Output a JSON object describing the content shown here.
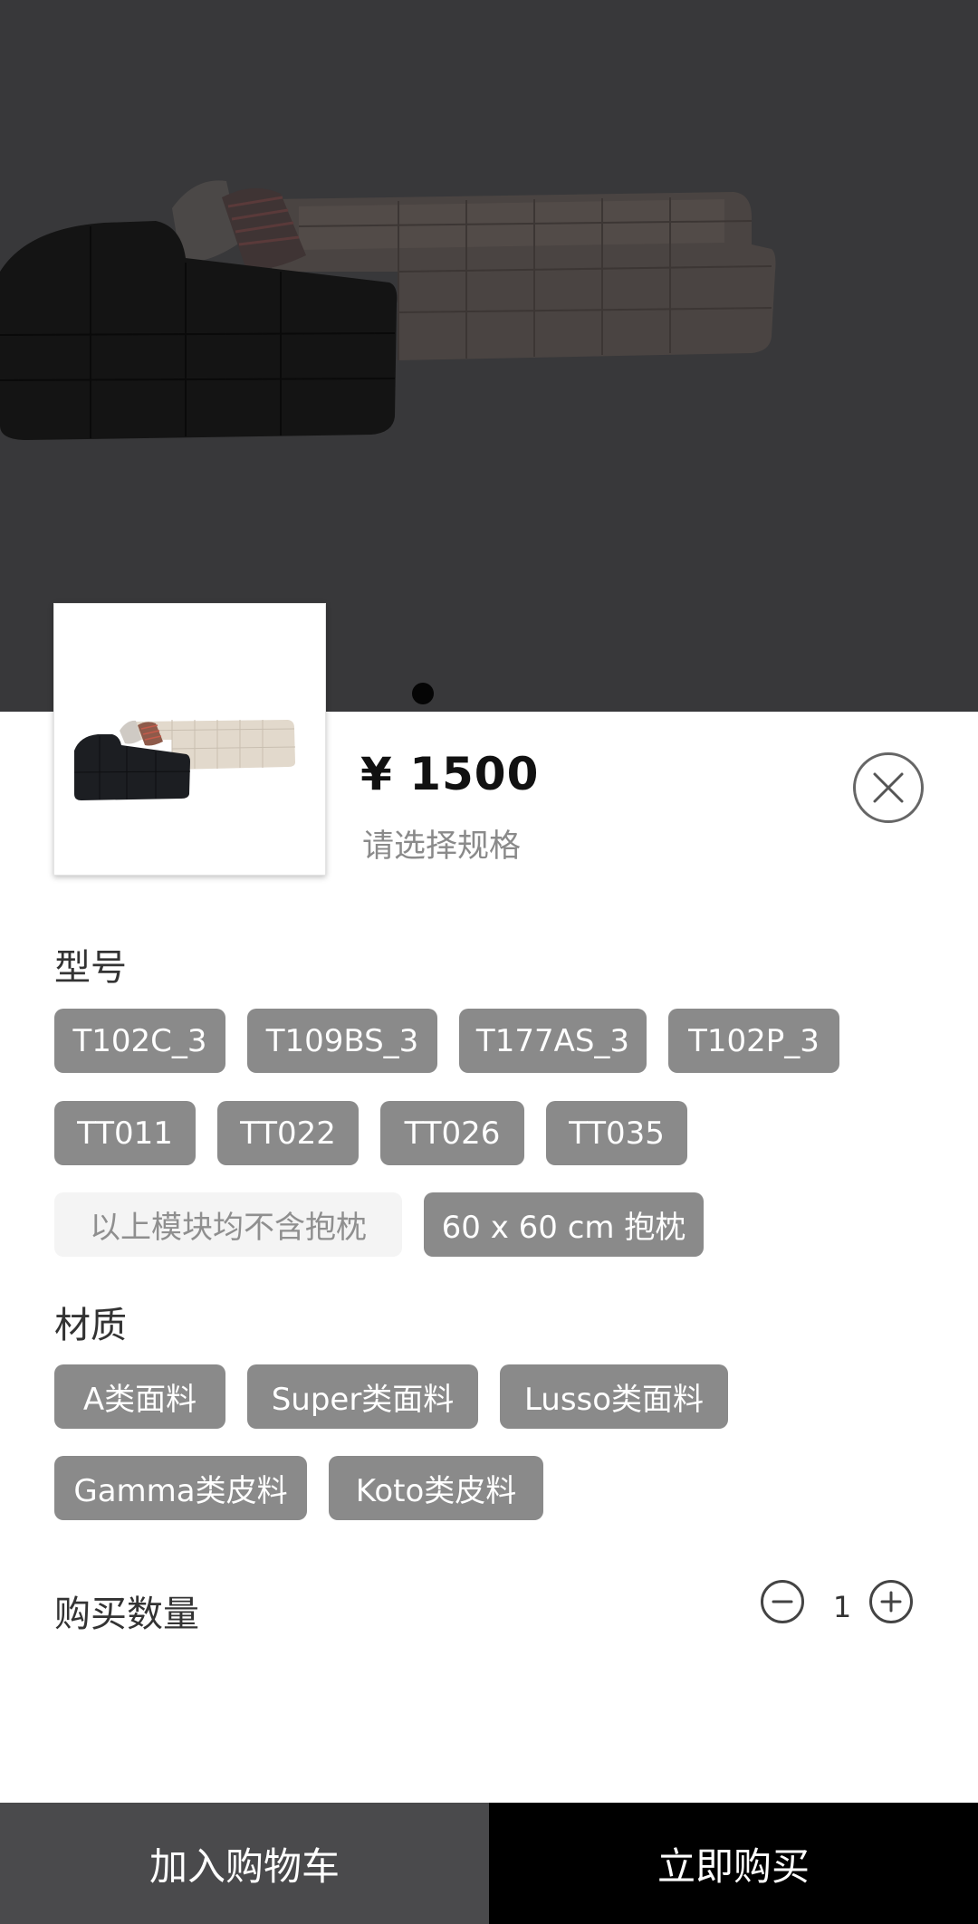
{
  "product": {
    "price": "¥ 1500",
    "spec_hint": "请选择规格"
  },
  "sections": {
    "model_title": "型号",
    "material_title": "材质"
  },
  "models": [
    "T102C_3",
    "T109BS_3",
    "T177AS_3",
    "T102P_3",
    "TT011",
    "TT022",
    "TT026",
    "TT035",
    "以上模块均不含抱枕",
    "60 x 60 cm 抱枕"
  ],
  "materials": [
    "A类面料",
    "Super类面料",
    "Lusso类面料",
    "Gamma类皮料",
    "Koto类皮料"
  ],
  "quantity": {
    "label": "购买数量",
    "value": "1"
  },
  "actions": {
    "add_to_cart": "加入购物车",
    "buy_now": "立即购买"
  },
  "icons": {
    "close": "close-icon",
    "minus": "minus-icon",
    "plus": "plus-icon"
  },
  "colors": {
    "chip_bg": "#8a8a8a",
    "chip_disabled_bg": "#f4f4f4",
    "cart_button_bg": "#4a4a4c",
    "buy_button_bg": "#000000",
    "backdrop": "#38383a"
  }
}
